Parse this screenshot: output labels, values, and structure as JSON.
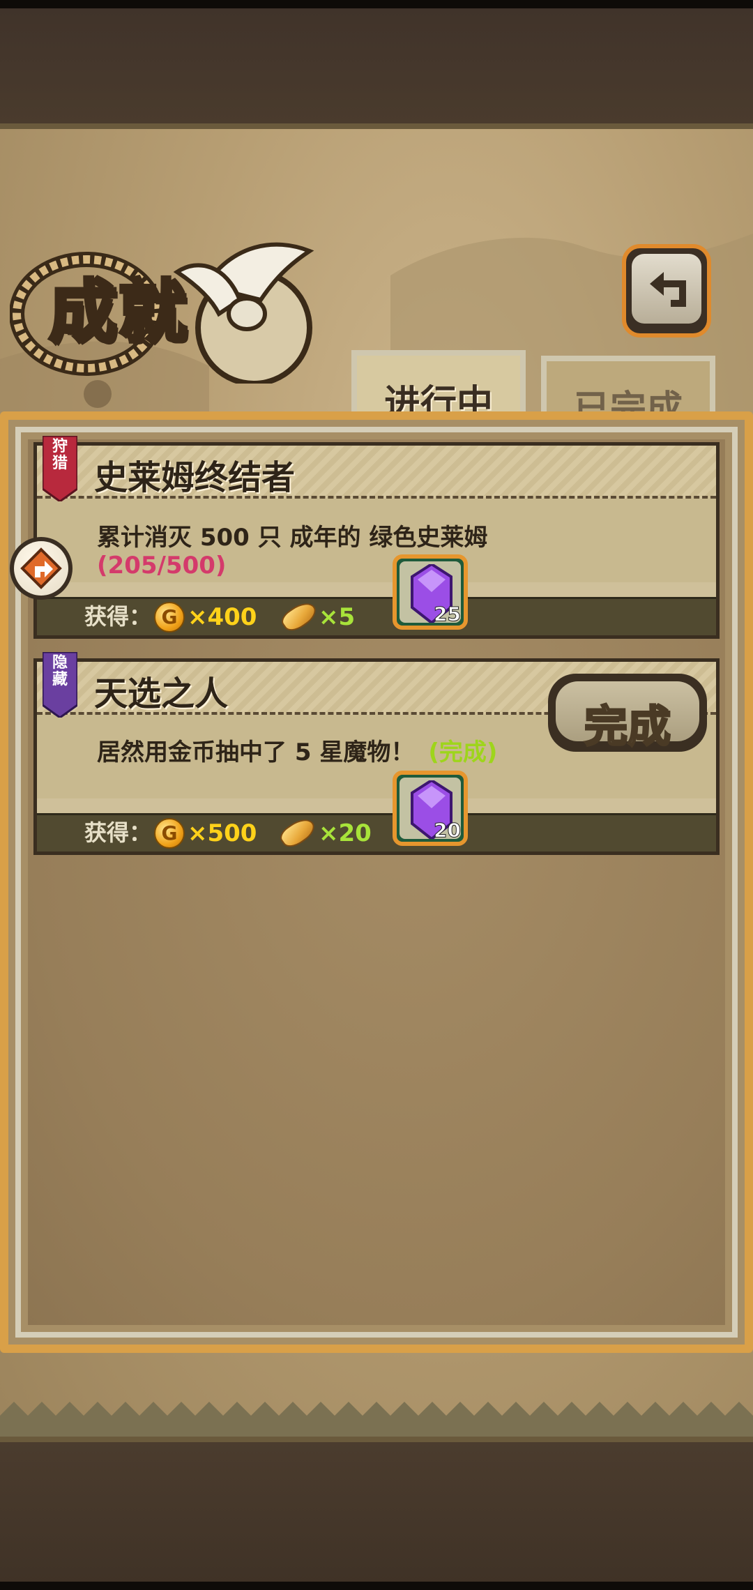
{
  "header": {
    "title": "成就",
    "back_icon": "back-arrow-icon"
  },
  "tabs": [
    {
      "label": "进行中",
      "active": true
    },
    {
      "label": "已完成",
      "active": false
    }
  ],
  "achievements": [
    {
      "badge": "狩猎",
      "badge_color": "#b8293d",
      "title": "史莱姆终结者",
      "description": "累计消灭 500 只 成年的 绿色史莱姆",
      "progress_text": "(205/500)",
      "reward_label": "获得：",
      "coin_amount": "×400",
      "bread_amount": "×5",
      "gem_count": "25",
      "completed": false
    },
    {
      "badge": "隐藏",
      "badge_color": "#6a3fa0",
      "title": "天选之人",
      "description": "居然用金币抽中了 5 星魔物！",
      "status_text": "(完成)",
      "reward_label": "获得：",
      "coin_amount": "×500",
      "bread_amount": "×20",
      "gem_count": "20",
      "completed": true,
      "button_label": "完成"
    }
  ],
  "icons": {
    "coin": "gold-coin-icon",
    "bread": "bread-icon",
    "gem": "purple-gem-icon",
    "side": "route-sign-icon"
  },
  "colors": {
    "accent": "#e08a2c",
    "progress": "#d43a6b",
    "done": "#9ed51b"
  }
}
